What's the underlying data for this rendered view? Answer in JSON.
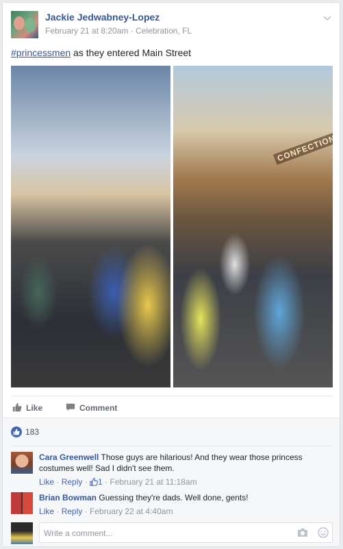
{
  "post": {
    "author": "Jackie Jedwabney-Lopez",
    "date": "February 21 at 8:20am",
    "separator": " · ",
    "location": "Celebration, FL",
    "hashtag": "#princessmen",
    "text_rest": " as they entered Main Street",
    "photo_sign": "CONFECTIONERY"
  },
  "actions": {
    "like": "Like",
    "comment": "Comment"
  },
  "reactions": {
    "count": "183"
  },
  "comments": [
    {
      "name": "Cara Greenwell",
      "text": "Those guys are hilarious! And they wear those princess costumes well! Sad I didn't see them.",
      "like": "Like",
      "reply": "Reply",
      "likes": "1",
      "time": "February 21 at 11:18am"
    },
    {
      "name": "Brian Bowman",
      "text": "Guessing they're dads. Well done, gents!",
      "like": "Like",
      "reply": "Reply",
      "time": "February 22 at 4:40am"
    }
  ],
  "composer": {
    "placeholder": "Write a comment..."
  },
  "colors": {
    "link": "#365899",
    "accent": "#4267b2",
    "meta": "#90949c"
  }
}
